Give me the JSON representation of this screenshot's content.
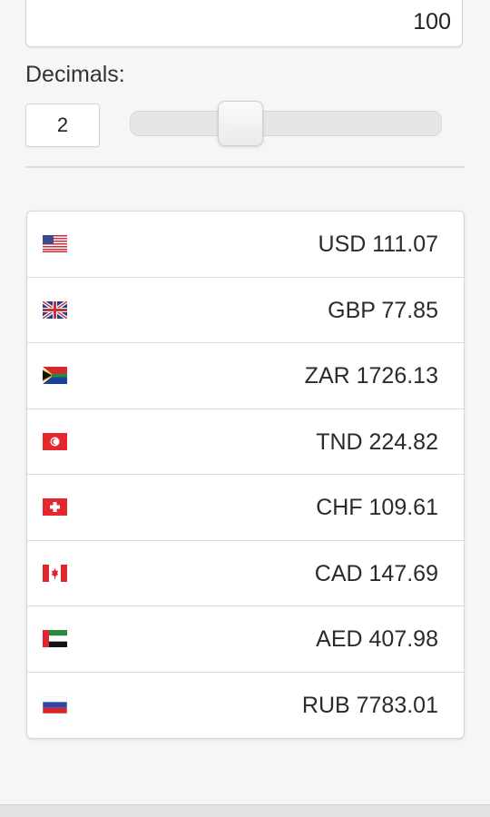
{
  "amount": {
    "value": "100"
  },
  "decimals": {
    "label": "Decimals:",
    "value": "2",
    "slider_level_fraction": 0.33
  },
  "currencies": [
    {
      "text": "USD 111.07",
      "flag": "us-flag-icon"
    },
    {
      "text": "GBP 77.85",
      "flag": "uk-flag-icon"
    },
    {
      "text": "ZAR 1726.13",
      "flag": "south-africa-flag-icon"
    },
    {
      "text": "TND 224.82",
      "flag": "tunisia-flag-icon"
    },
    {
      "text": "CHF 109.61",
      "flag": "switzerland-flag-icon"
    },
    {
      "text": "CAD 147.69",
      "flag": "canada-flag-icon"
    },
    {
      "text": "AED 407.98",
      "flag": "uae-flag-icon"
    },
    {
      "text": "RUB 7783.01",
      "flag": "russia-flag-icon"
    }
  ]
}
